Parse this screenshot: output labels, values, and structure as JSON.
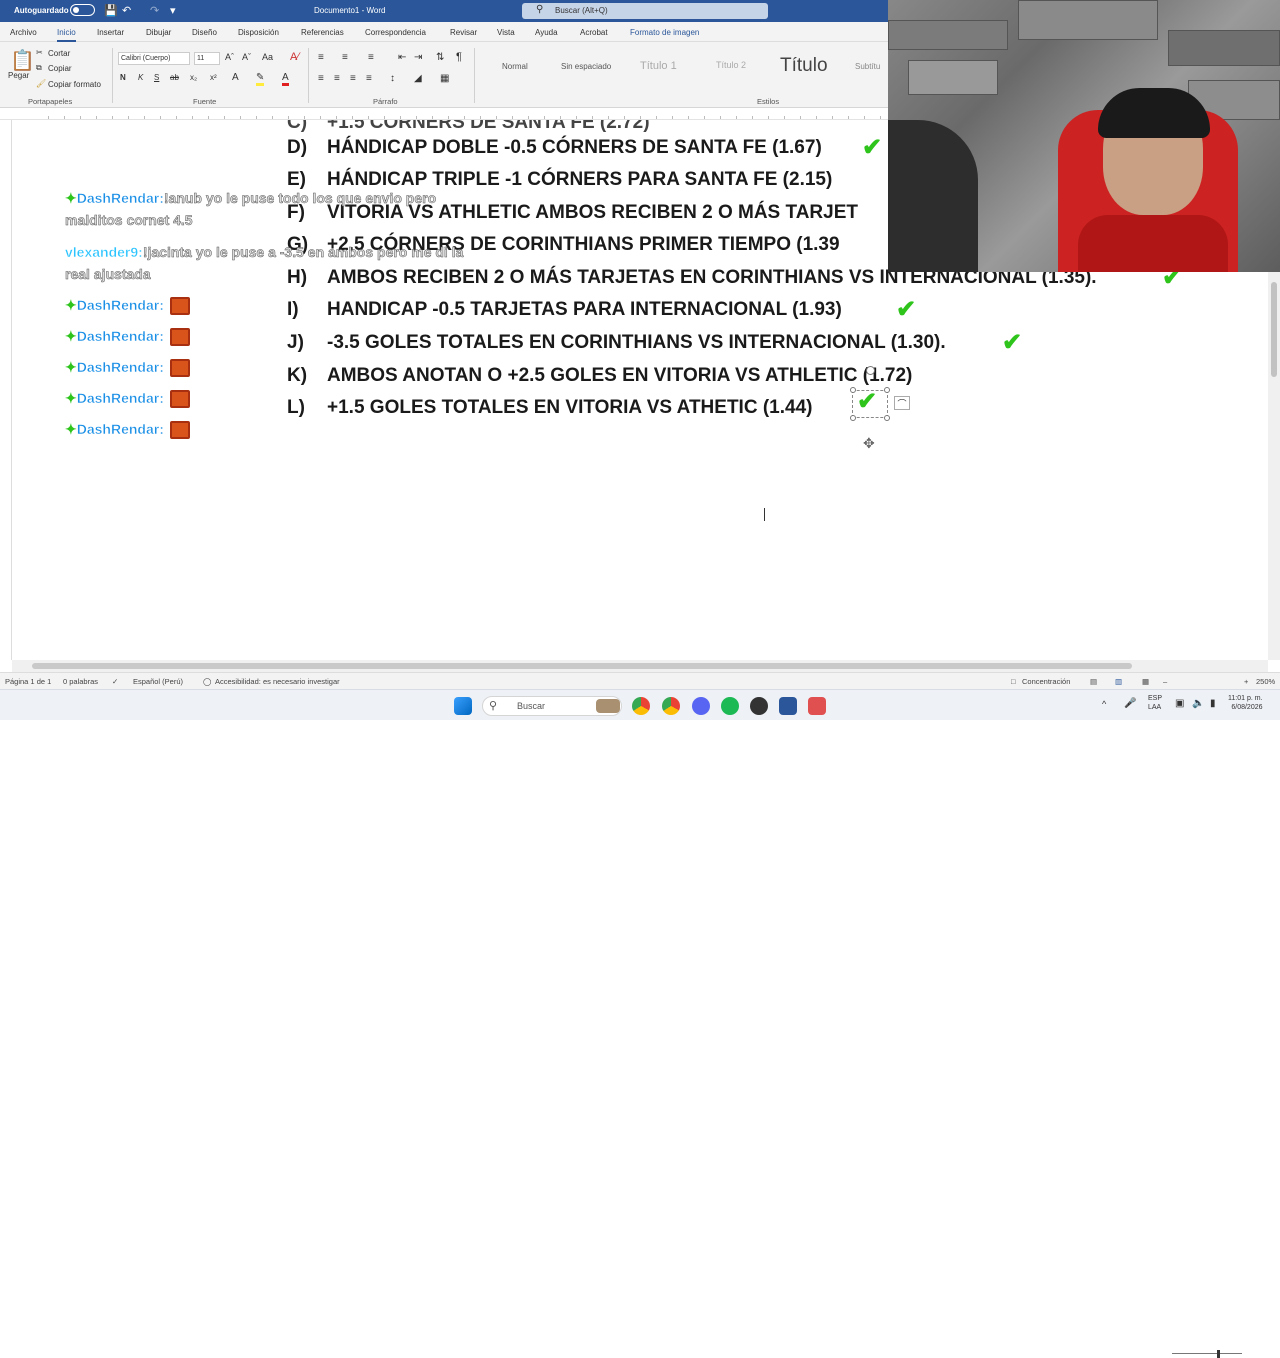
{
  "titlebar": {
    "autosave": "Autoguardado",
    "document_title": "Documento1 - Word",
    "search_placeholder": "Buscar (Alt+Q)"
  },
  "menu": [
    "Archivo",
    "Inicio",
    "Insertar",
    "Dibujar",
    "Diseño",
    "Disposición",
    "Referencias",
    "Correspondencia",
    "Revisar",
    "Vista",
    "Ayuda",
    "Acrobat",
    "Formato de imagen"
  ],
  "ribbon": {
    "paste": "Pegar",
    "cut": "Cortar",
    "copy": "Copiar",
    "format_painter": "Copiar formato",
    "clipboard_label": "Portapapeles",
    "font_name": "Calibri (Cuerpo)",
    "font_size": "11",
    "font_label": "Fuente",
    "paragraph_label": "Párrafo",
    "styles_label": "Estilos",
    "styles": [
      "Normal",
      "Sin espaciado",
      "Título 1",
      "Título 2",
      "Título",
      "Subtítu"
    ]
  },
  "document_lines": [
    {
      "letter": "D)",
      "text": "HÁNDICAP DOBLE -0.5 CÓRNERS DE SANTA FE (1.67)"
    },
    {
      "letter": "E)",
      "text": "HÁNDICAP TRIPLE -1 CÓRNERS PARA SANTA FE (2.15)"
    },
    {
      "letter": "F)",
      "text": "VITORIA VS ATHLETIC AMBOS RECIBEN 2 O MÁS TARJET"
    },
    {
      "letter": "G)",
      "text": "+2.5 CÓRNERS DE CORINTHIANS PRIMER TIEMPO (1.39"
    },
    {
      "letter": "H)",
      "text": "AMBOS RECIBEN 2 O MÁS TARJETAS EN CORINTHIANS VS INTERNACIONAL (1.35)."
    },
    {
      "letter": "I)",
      "text": "HANDICAP -0.5 TARJETAS PARA INTERNACIONAL (1.93)"
    },
    {
      "letter": "J)",
      "text": "-3.5 GOLES TOTALES EN CORINTHIANS VS INTERNACIONAL (1.30)."
    },
    {
      "letter": "K)",
      "text": "AMBOS ANOTAN O +2.5 GOLES EN VITORIA VS ATHLETIC (1.72)"
    },
    {
      "letter": "L)",
      "text": "+1.5 GOLES TOTALES EN VITORIA VS ATHETIC (1.44)"
    }
  ],
  "chat": [
    {
      "user": "DashRendar:",
      "msg": "!anub yo le puse todo los que envio pero"
    },
    {
      "user": "",
      "msg": "malditos cornet 4.5"
    },
    {
      "user": "vlexander9:",
      "msg": "!jacinta yo le puse a -3.5 en ambos pero me di la"
    },
    {
      "user": "",
      "msg": "real ajustada"
    },
    {
      "user": "DashRendar:",
      "msg": ""
    },
    {
      "user": "DashRendar:",
      "msg": ""
    },
    {
      "user": "DashRendar:",
      "msg": ""
    },
    {
      "user": "DashRendar:",
      "msg": ""
    },
    {
      "user": "DashRendar:",
      "msg": ""
    }
  ],
  "statusbar": {
    "page": "Página 1 de 1",
    "words": "0 palabras",
    "language": "Español (Perú)",
    "accessibility": "Accesibilidad: es necesario investigar",
    "focus": "Concentración",
    "zoom": "250%"
  },
  "taskbar": {
    "search": "Buscar",
    "lang1": "ESP",
    "lang2": "LAA",
    "time": "11:01 p. m.",
    "date": "6/08/2026"
  },
  "colors": {
    "word_blue": "#2b579a",
    "check_green": "#2ec41b",
    "chat_user": "#1a8fe6"
  }
}
